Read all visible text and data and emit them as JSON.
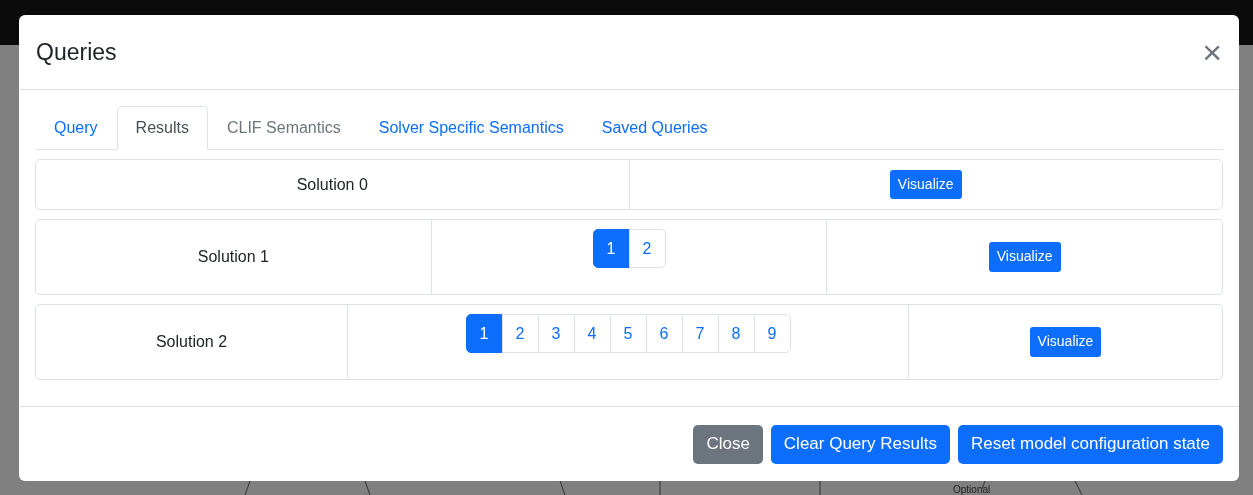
{
  "modal": {
    "title": "Queries",
    "close": "×"
  },
  "tabs": [
    {
      "label": "Query",
      "selected": false,
      "disabled": false
    },
    {
      "label": "Results",
      "selected": true,
      "disabled": false
    },
    {
      "label": "CLIF Semantics",
      "selected": false,
      "disabled": true
    },
    {
      "label": "Solver Specific Semantics",
      "selected": false,
      "disabled": false
    },
    {
      "label": "Saved Queries",
      "selected": false,
      "disabled": false
    }
  ],
  "solutions": [
    {
      "label": "Solution 0",
      "button": "Visualize"
    },
    {
      "label": "Solution 1",
      "pages": [
        {
          "label": "1",
          "selected": true
        },
        {
          "label": "2",
          "selected": false
        }
      ],
      "button": "Visualize"
    },
    {
      "label": "Solution 2",
      "pages": [
        {
          "label": "1",
          "selected": true
        },
        {
          "label": "2",
          "selected": false
        },
        {
          "label": "3",
          "selected": false
        },
        {
          "label": "4",
          "selected": false
        },
        {
          "label": "5",
          "selected": false
        },
        {
          "label": "6",
          "selected": false
        },
        {
          "label": "7",
          "selected": false
        },
        {
          "label": "8",
          "selected": false
        },
        {
          "label": "9",
          "selected": false
        }
      ],
      "button": "Visualize"
    }
  ],
  "footer_buttons": [
    {
      "label": "Close",
      "kind": "secondary"
    },
    {
      "label": "Clear Query Results",
      "kind": "primary"
    },
    {
      "label": "Reset model configuration state",
      "kind": "primary"
    }
  ],
  "background": {
    "label": "Optional"
  }
}
